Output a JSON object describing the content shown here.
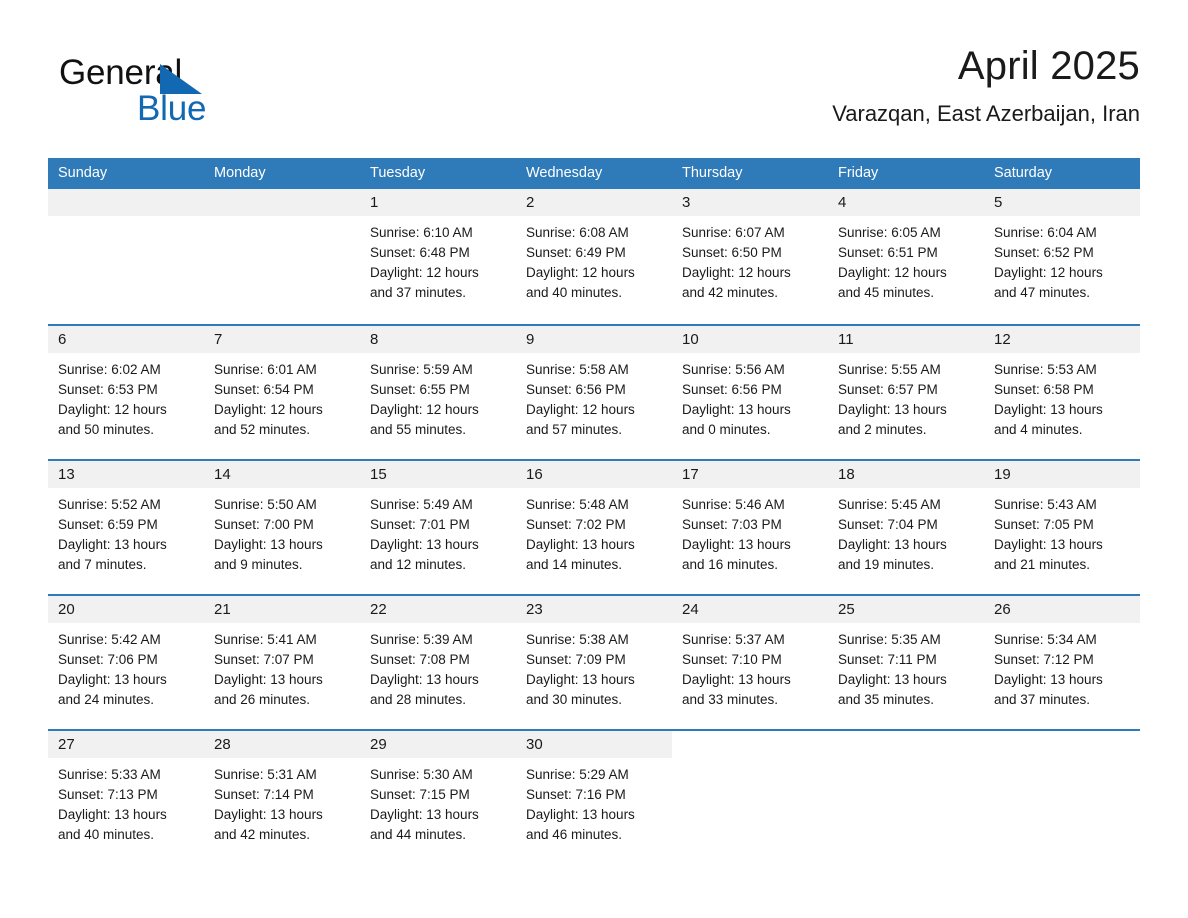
{
  "brand": {
    "name_part1": "General",
    "name_part2": "Blue",
    "accent_color": "#1268b3"
  },
  "header": {
    "title": "April 2025",
    "subtitle": "Varazqan, East Azerbaijan, Iran"
  },
  "calendar": {
    "header_color": "#2f7ab8",
    "date_band_color": "#f1f1f1",
    "weekdays": [
      "Sunday",
      "Monday",
      "Tuesday",
      "Wednesday",
      "Thursday",
      "Friday",
      "Saturday"
    ],
    "weeks": [
      [
        {
          "date": "",
          "lines": []
        },
        {
          "date": "",
          "lines": []
        },
        {
          "date": "1",
          "lines": [
            "Sunrise: 6:10 AM",
            "Sunset: 6:48 PM",
            "Daylight: 12 hours",
            "and 37 minutes."
          ]
        },
        {
          "date": "2",
          "lines": [
            "Sunrise: 6:08 AM",
            "Sunset: 6:49 PM",
            "Daylight: 12 hours",
            "and 40 minutes."
          ]
        },
        {
          "date": "3",
          "lines": [
            "Sunrise: 6:07 AM",
            "Sunset: 6:50 PM",
            "Daylight: 12 hours",
            "and 42 minutes."
          ]
        },
        {
          "date": "4",
          "lines": [
            "Sunrise: 6:05 AM",
            "Sunset: 6:51 PM",
            "Daylight: 12 hours",
            "and 45 minutes."
          ]
        },
        {
          "date": "5",
          "lines": [
            "Sunrise: 6:04 AM",
            "Sunset: 6:52 PM",
            "Daylight: 12 hours",
            "and 47 minutes."
          ]
        }
      ],
      [
        {
          "date": "6",
          "lines": [
            "Sunrise: 6:02 AM",
            "Sunset: 6:53 PM",
            "Daylight: 12 hours",
            "and 50 minutes."
          ]
        },
        {
          "date": "7",
          "lines": [
            "Sunrise: 6:01 AM",
            "Sunset: 6:54 PM",
            "Daylight: 12 hours",
            "and 52 minutes."
          ]
        },
        {
          "date": "8",
          "lines": [
            "Sunrise: 5:59 AM",
            "Sunset: 6:55 PM",
            "Daylight: 12 hours",
            "and 55 minutes."
          ]
        },
        {
          "date": "9",
          "lines": [
            "Sunrise: 5:58 AM",
            "Sunset: 6:56 PM",
            "Daylight: 12 hours",
            "and 57 minutes."
          ]
        },
        {
          "date": "10",
          "lines": [
            "Sunrise: 5:56 AM",
            "Sunset: 6:56 PM",
            "Daylight: 13 hours",
            "and 0 minutes."
          ]
        },
        {
          "date": "11",
          "lines": [
            "Sunrise: 5:55 AM",
            "Sunset: 6:57 PM",
            "Daylight: 13 hours",
            "and 2 minutes."
          ]
        },
        {
          "date": "12",
          "lines": [
            "Sunrise: 5:53 AM",
            "Sunset: 6:58 PM",
            "Daylight: 13 hours",
            "and 4 minutes."
          ]
        }
      ],
      [
        {
          "date": "13",
          "lines": [
            "Sunrise: 5:52 AM",
            "Sunset: 6:59 PM",
            "Daylight: 13 hours",
            "and 7 minutes."
          ]
        },
        {
          "date": "14",
          "lines": [
            "Sunrise: 5:50 AM",
            "Sunset: 7:00 PM",
            "Daylight: 13 hours",
            "and 9 minutes."
          ]
        },
        {
          "date": "15",
          "lines": [
            "Sunrise: 5:49 AM",
            "Sunset: 7:01 PM",
            "Daylight: 13 hours",
            "and 12 minutes."
          ]
        },
        {
          "date": "16",
          "lines": [
            "Sunrise: 5:48 AM",
            "Sunset: 7:02 PM",
            "Daylight: 13 hours",
            "and 14 minutes."
          ]
        },
        {
          "date": "17",
          "lines": [
            "Sunrise: 5:46 AM",
            "Sunset: 7:03 PM",
            "Daylight: 13 hours",
            "and 16 minutes."
          ]
        },
        {
          "date": "18",
          "lines": [
            "Sunrise: 5:45 AM",
            "Sunset: 7:04 PM",
            "Daylight: 13 hours",
            "and 19 minutes."
          ]
        },
        {
          "date": "19",
          "lines": [
            "Sunrise: 5:43 AM",
            "Sunset: 7:05 PM",
            "Daylight: 13 hours",
            "and 21 minutes."
          ]
        }
      ],
      [
        {
          "date": "20",
          "lines": [
            "Sunrise: 5:42 AM",
            "Sunset: 7:06 PM",
            "Daylight: 13 hours",
            "and 24 minutes."
          ]
        },
        {
          "date": "21",
          "lines": [
            "Sunrise: 5:41 AM",
            "Sunset: 7:07 PM",
            "Daylight: 13 hours",
            "and 26 minutes."
          ]
        },
        {
          "date": "22",
          "lines": [
            "Sunrise: 5:39 AM",
            "Sunset: 7:08 PM",
            "Daylight: 13 hours",
            "and 28 minutes."
          ]
        },
        {
          "date": "23",
          "lines": [
            "Sunrise: 5:38 AM",
            "Sunset: 7:09 PM",
            "Daylight: 13 hours",
            "and 30 minutes."
          ]
        },
        {
          "date": "24",
          "lines": [
            "Sunrise: 5:37 AM",
            "Sunset: 7:10 PM",
            "Daylight: 13 hours",
            "and 33 minutes."
          ]
        },
        {
          "date": "25",
          "lines": [
            "Sunrise: 5:35 AM",
            "Sunset: 7:11 PM",
            "Daylight: 13 hours",
            "and 35 minutes."
          ]
        },
        {
          "date": "26",
          "lines": [
            "Sunrise: 5:34 AM",
            "Sunset: 7:12 PM",
            "Daylight: 13 hours",
            "and 37 minutes."
          ]
        }
      ],
      [
        {
          "date": "27",
          "lines": [
            "Sunrise: 5:33 AM",
            "Sunset: 7:13 PM",
            "Daylight: 13 hours",
            "and 40 minutes."
          ]
        },
        {
          "date": "28",
          "lines": [
            "Sunrise: 5:31 AM",
            "Sunset: 7:14 PM",
            "Daylight: 13 hours",
            "and 42 minutes."
          ]
        },
        {
          "date": "29",
          "lines": [
            "Sunrise: 5:30 AM",
            "Sunset: 7:15 PM",
            "Daylight: 13 hours",
            "and 44 minutes."
          ]
        },
        {
          "date": "30",
          "lines": [
            "Sunrise: 5:29 AM",
            "Sunset: 7:16 PM",
            "Daylight: 13 hours",
            "and 46 minutes."
          ]
        },
        {
          "date": "",
          "lines": []
        },
        {
          "date": "",
          "lines": []
        },
        {
          "date": "",
          "lines": []
        }
      ]
    ]
  }
}
